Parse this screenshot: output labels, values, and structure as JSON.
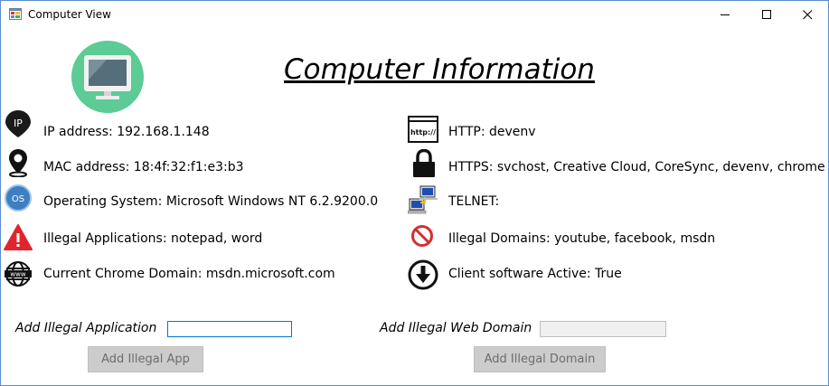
{
  "window": {
    "title": "Computer View",
    "controls": {
      "minimize": "minimize",
      "maximize": "maximize",
      "close": "close"
    }
  },
  "heading": "Computer Information",
  "info_left": [
    {
      "text": "IP address: 192.168.1.148",
      "icon": "ip-pin-icon",
      "icon_text": "IP"
    },
    {
      "text": "MAC address: 18:4f:32:f1:e3:b3",
      "icon": "location-pin-icon"
    },
    {
      "text": "Operating System: Microsoft Windows NT 6.2.9200.0",
      "icon": "os-icon",
      "icon_text": "OS"
    },
    {
      "text": "Illegal Applications: notepad, word",
      "icon": "warning-icon"
    },
    {
      "text": "Current Chrome Domain: msdn.microsoft.com",
      "icon": "www-globe-icon",
      "icon_text": "www"
    }
  ],
  "info_right": [
    {
      "text": "HTTP: devenv",
      "icon": "http-browser-icon",
      "icon_text": "http://"
    },
    {
      "text": "HTTPS: svchost, Creative Cloud, CoreSync, devenv, chrome",
      "icon": "lock-icon"
    },
    {
      "text": "TELNET:",
      "icon": "network-computers-icon"
    },
    {
      "text": "Illegal Domains: youtube, facebook, msdn",
      "icon": "prohibited-icon"
    },
    {
      "text": "Client software Active: True",
      "icon": "download-arrow-icon"
    }
  ],
  "form": {
    "app_label": "Add Illegal Application",
    "app_value": "",
    "app_button": "Add Illegal App",
    "domain_label": "Add Illegal Web Domain",
    "domain_value": "",
    "domain_button": "Add Illegal Domain"
  },
  "colors": {
    "logo_circle": "#5ccb95",
    "warning": "#e0262c",
    "prohibited": "#d32f2f",
    "window_border": "#5b8ecf",
    "focus_border": "#0078d7",
    "button_bg": "#cccccc"
  }
}
